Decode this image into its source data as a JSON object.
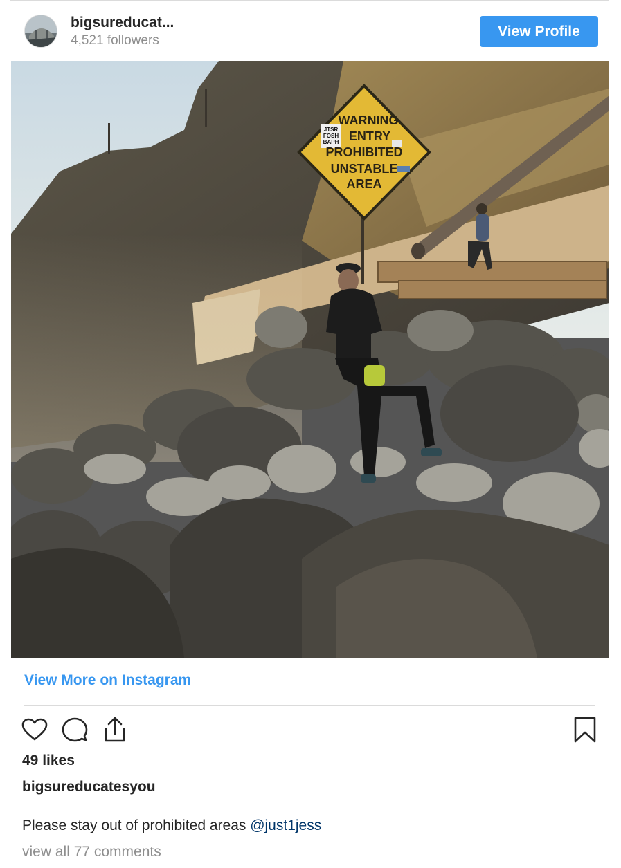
{
  "header": {
    "username": "bigsureducat...",
    "followers": "4,521 followers",
    "view_profile_label": "View Profile",
    "avatar_icon": "profile-avatar"
  },
  "photo": {
    "sign_lines": [
      "WARNING",
      "ENTRY",
      "PROHIBITED",
      "UNSTABLE",
      "AREA"
    ],
    "sticker_text": [
      "JTSR",
      "FOSH",
      "BAPH"
    ]
  },
  "links": {
    "view_more": "View More on Instagram"
  },
  "actions": {
    "like_icon": "heart-icon",
    "comment_icon": "comment-icon",
    "share_icon": "share-icon",
    "save_icon": "bookmark-icon"
  },
  "post": {
    "likes": "49 likes",
    "caption_user": "bigsureducatesyou",
    "caption_text": "Please stay out of prohibited areas ",
    "mention": "@just1jess",
    "comments_link": "view all 77 comments"
  },
  "colors": {
    "accent": "#3897f0",
    "text": "#262626",
    "muted": "#8e8e8e",
    "mention": "#003569"
  }
}
